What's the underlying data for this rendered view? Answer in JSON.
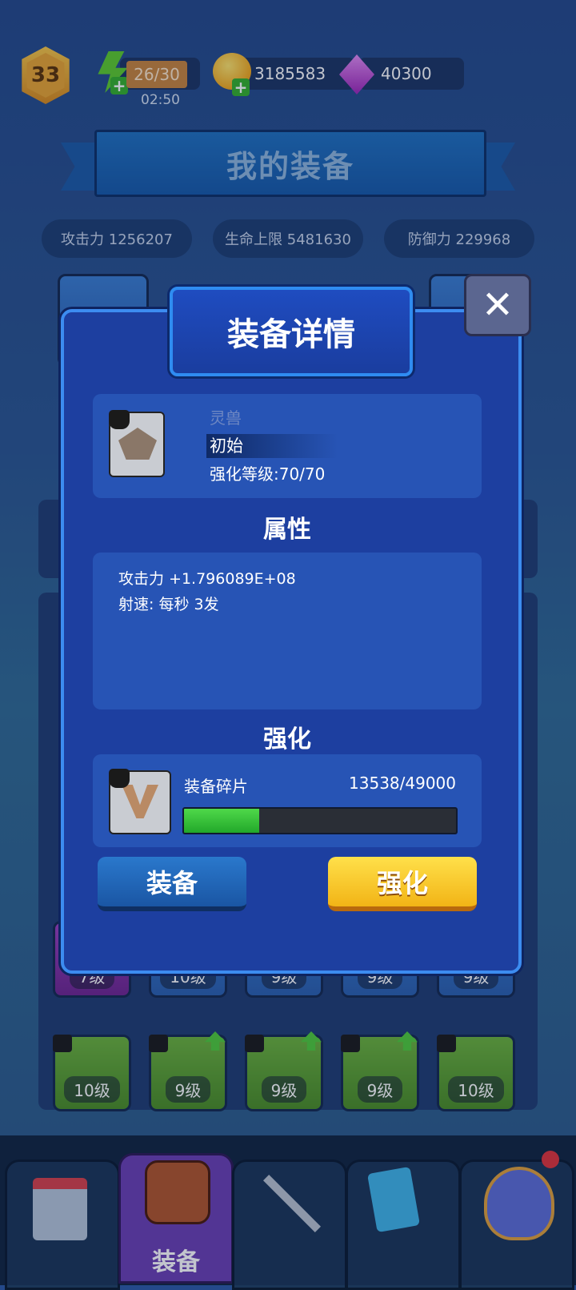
{
  "top_bar": {
    "level": "33",
    "energy": "26/30",
    "energy_timer": "02:50",
    "gold": "3185583",
    "gems": "40300"
  },
  "page_title": "我的装备",
  "stats": {
    "attack": "攻击力 1256207",
    "hp": "生命上限 5481630",
    "defense": "防御力 229968"
  },
  "grid": {
    "row1": [
      {
        "label": "7级",
        "color": "purple"
      },
      {
        "label": "10级",
        "color": "blue"
      },
      {
        "label": "9级",
        "color": "blue"
      },
      {
        "label": "9级",
        "color": "blue"
      },
      {
        "label": "9级",
        "color": "blue"
      }
    ],
    "row2": [
      {
        "label": "10级",
        "color": "green",
        "upgrade": false
      },
      {
        "label": "9级",
        "color": "green",
        "upgrade": true
      },
      {
        "label": "9级",
        "color": "green",
        "upgrade": true
      },
      {
        "label": "9级",
        "color": "green",
        "upgrade": true
      },
      {
        "label": "10级",
        "color": "green",
        "upgrade": false
      }
    ]
  },
  "modal": {
    "title": "装备详情",
    "close_icon": "close-icon",
    "item": {
      "name": "灵兽",
      "quality": "初始",
      "enhance_level": "强化等级:70/70"
    },
    "attributes_heading": "属性",
    "attributes": [
      "攻击力 +1.796089E+08",
      "射速: 每秒 3发"
    ],
    "enhance_heading": "强化",
    "shard": {
      "name": "装备碎片",
      "progress_text": "13538/49000",
      "progress_fraction": 0.276
    },
    "equip_button": "装备",
    "enhance_button": "强化"
  },
  "bottom_nav": {
    "active_label": "装备",
    "icons": [
      "shop-icon",
      "backpack-icon",
      "crossed-swords-icon",
      "cards-icon",
      "crown-shield-icon"
    ]
  },
  "colors": {
    "modal_bg": "#1d3fa0",
    "modal_border": "#3c8cf0",
    "progress_fill": "#2fc234",
    "enhance_button": "#f6c52e",
    "equip_button": "#1f5fae"
  }
}
